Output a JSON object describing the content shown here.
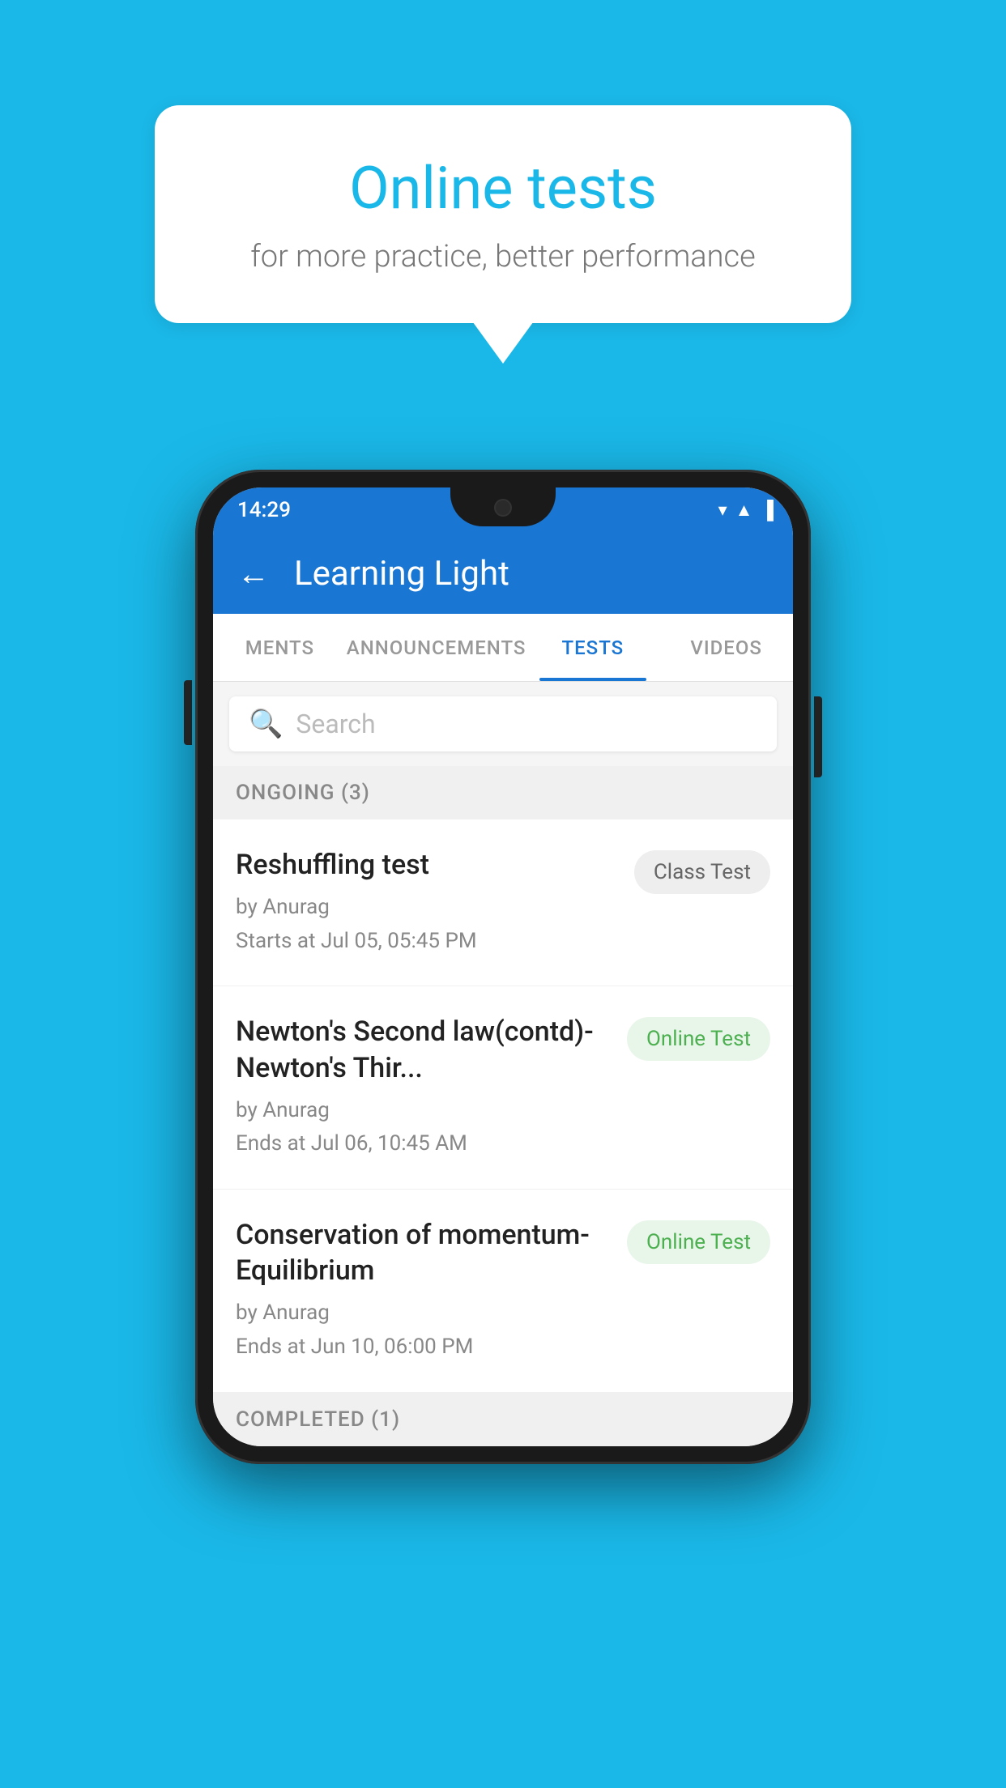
{
  "background": {
    "color": "#1ab8e8"
  },
  "speech_bubble": {
    "title": "Online tests",
    "subtitle": "for more practice, better performance"
  },
  "phone": {
    "status_bar": {
      "time": "14:29",
      "icons": [
        "wifi",
        "signal",
        "battery"
      ]
    },
    "app_bar": {
      "back_label": "←",
      "title": "Learning Light"
    },
    "tabs": [
      {
        "label": "MENTS",
        "active": false
      },
      {
        "label": "ANNOUNCEMENTS",
        "active": false
      },
      {
        "label": "TESTS",
        "active": true
      },
      {
        "label": "VIDEOS",
        "active": false
      }
    ],
    "search": {
      "placeholder": "Search"
    },
    "sections": [
      {
        "header": "ONGOING (3)",
        "items": [
          {
            "title": "Reshuffling test",
            "by": "by Anurag",
            "time": "Starts at  Jul 05, 05:45 PM",
            "badge": "Class Test",
            "badge_type": "class"
          },
          {
            "title": "Newton's Second law(contd)-Newton's Thir...",
            "by": "by Anurag",
            "time": "Ends at  Jul 06, 10:45 AM",
            "badge": "Online Test",
            "badge_type": "online"
          },
          {
            "title": "Conservation of momentum-Equilibrium",
            "by": "by Anurag",
            "time": "Ends at  Jun 10, 06:00 PM",
            "badge": "Online Test",
            "badge_type": "online"
          }
        ]
      }
    ],
    "completed_header": "COMPLETED (1)"
  }
}
